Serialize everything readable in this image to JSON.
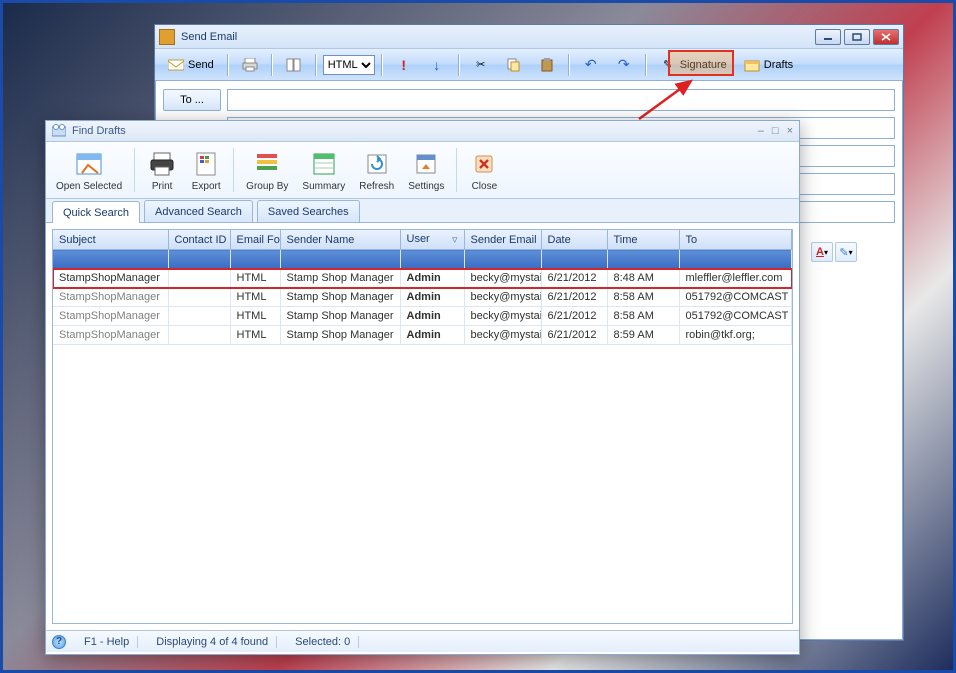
{
  "sendEmail": {
    "title": "Send Email",
    "toolbar": {
      "send": "Send",
      "format_select": "HTML",
      "signature": "Signature",
      "drafts": "Drafts"
    },
    "to_label": "To ..."
  },
  "findDrafts": {
    "title": "Find Drafts",
    "ribbon": {
      "open_selected": "Open Selected",
      "print": "Print",
      "export": "Export",
      "group_by": "Group By",
      "summary": "Summary",
      "refresh": "Refresh",
      "settings": "Settings",
      "close": "Close"
    },
    "tabs": {
      "quick": "Quick Search",
      "advanced": "Advanced Search",
      "saved": "Saved Searches"
    },
    "columns": {
      "subject": "Subject",
      "contact_id": "Contact ID",
      "email_fo": "Email Fo",
      "sender_name": "Sender Name",
      "user": "User",
      "sender_email": "Sender Email",
      "date": "Date",
      "time": "Time",
      "to": "To"
    },
    "rows": [
      {
        "subject": "StampShopManager",
        "contact_id": "",
        "email_fo": "HTML",
        "sender_name": "Stamp Shop Manager",
        "user": "Admin",
        "sender_email": "becky@mystai",
        "date": "6/21/2012",
        "time": "8:48 AM",
        "to": "mleffler@leffler.com"
      },
      {
        "subject": "StampShopManager",
        "contact_id": "",
        "email_fo": "HTML",
        "sender_name": "Stamp Shop Manager",
        "user": "Admin",
        "sender_email": "becky@mystai",
        "date": "6/21/2012",
        "time": "8:58 AM",
        "to": "051792@COMCAST"
      },
      {
        "subject": "StampShopManager",
        "contact_id": "",
        "email_fo": "HTML",
        "sender_name": "Stamp Shop Manager",
        "user": "Admin",
        "sender_email": "becky@mystai",
        "date": "6/21/2012",
        "time": "8:58 AM",
        "to": "051792@COMCAST"
      },
      {
        "subject": "StampShopManager",
        "contact_id": "",
        "email_fo": "HTML",
        "sender_name": "Stamp Shop Manager",
        "user": "Admin",
        "sender_email": "becky@mystai",
        "date": "6/21/2012",
        "time": "8:59 AM",
        "to": "robin@tkf.org;"
      }
    ],
    "status": {
      "help": "F1 - Help",
      "displaying": "Displaying 4 of 4 found",
      "selected": "Selected: 0"
    }
  }
}
